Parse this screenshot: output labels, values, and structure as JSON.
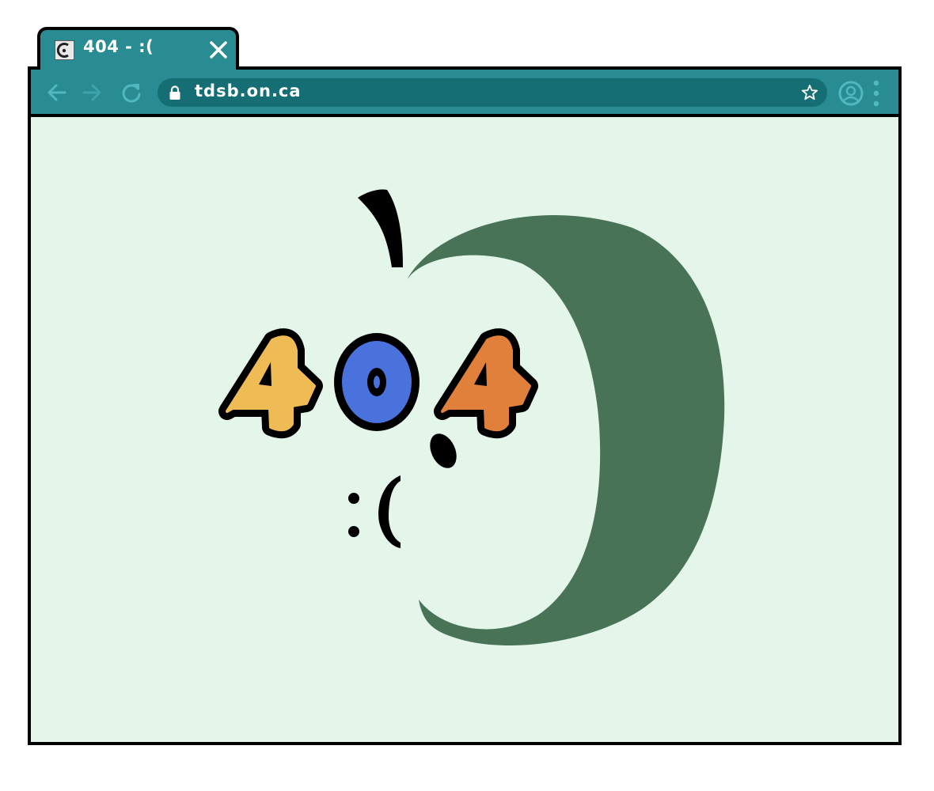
{
  "tab": {
    "title": "404 - :(",
    "favicon": "school-apple-favicon-icon",
    "close_icon": "close-icon"
  },
  "toolbar": {
    "back_icon": "arrow-left-icon",
    "forward_icon": "arrow-right-icon",
    "reload_icon": "reload-icon",
    "url": "tdsb.on.ca",
    "lock_icon": "lock-icon",
    "bookmark_icon": "star-icon",
    "profile_icon": "profile-icon",
    "menu_icon": "more-vertical-icon"
  },
  "page": {
    "error_code": "404",
    "digits": [
      "4",
      "0",
      "4"
    ],
    "emoticon": ":("
  },
  "colors": {
    "chrome_teal": "#2a8c93",
    "address_bar": "#146e73",
    "page_background": "#e4f5ea",
    "apple_green": "#487356",
    "digit_1_yellow": "#f0b94e",
    "digit_0_blue": "#4a72dc",
    "digit_3_orange": "#e0803a"
  }
}
